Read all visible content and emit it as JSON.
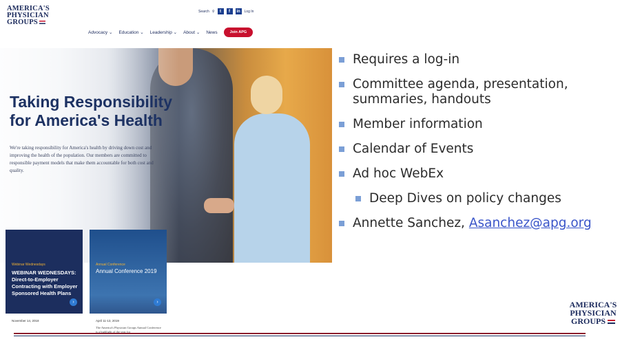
{
  "website": {
    "logo": {
      "line1": "AMERICA'S",
      "line2": "PHYSICIAN",
      "line3": "GROUPS"
    },
    "utility": {
      "search_label": "Search",
      "login_label": "Log In",
      "social": [
        "t",
        "f",
        "in"
      ]
    },
    "nav": [
      {
        "label": "Advocacy",
        "icon": "chevron-down"
      },
      {
        "label": "Education",
        "icon": "chevron-down"
      },
      {
        "label": "Leadership",
        "icon": "chevron-down"
      },
      {
        "label": "About",
        "icon": "chevron-down"
      },
      {
        "label": "News"
      }
    ],
    "join_button": "Join APG",
    "hero": {
      "title_line1": "Taking Responsibility",
      "title_line2": "for America's Health",
      "text": "We're taking responsibility for America's health by driving down cost and improving the health of the population. Our members are committed to responsible payment models that make them accountable for both cost and quality."
    },
    "cards": [
      {
        "kicker": "Webinar Wednesdays",
        "title": "WEBINAR WEDNESDAYS: Direct-to-Employer Contracting with Employer Sponsored Health Plans",
        "date": "November 14, 2018",
        "desc": ""
      },
      {
        "kicker": "Annual Conference",
        "title": "Annual Conference 2019",
        "date": "April 11-13, 2019",
        "desc": "The America's Physician Groups Annual Conference is a highlight of the year for"
      }
    ]
  },
  "bullets": [
    {
      "text": "Requires a log-in",
      "level": 1
    },
    {
      "text": "Committee agenda, presentation, summaries, handouts",
      "level": 1
    },
    {
      "text": "Member information",
      "level": 1
    },
    {
      "text": "Calendar of Events",
      "level": 1
    },
    {
      "text": "Ad hoc WebEx",
      "level": 1
    },
    {
      "text": "Deep Dives on policy changes",
      "level": 2
    }
  ],
  "contact": {
    "name": "Annette Sanchez, ",
    "email": "Asanchez@apg.org"
  },
  "footer_logo": {
    "line1": "AMERICA'S",
    "line2": "PHYSICIAN",
    "line3": "GROUPS"
  },
  "colors": {
    "navy": "#1b2a5c",
    "red": "#c8102e",
    "bullet": "#7b9fd6",
    "link": "#3a55c9"
  }
}
